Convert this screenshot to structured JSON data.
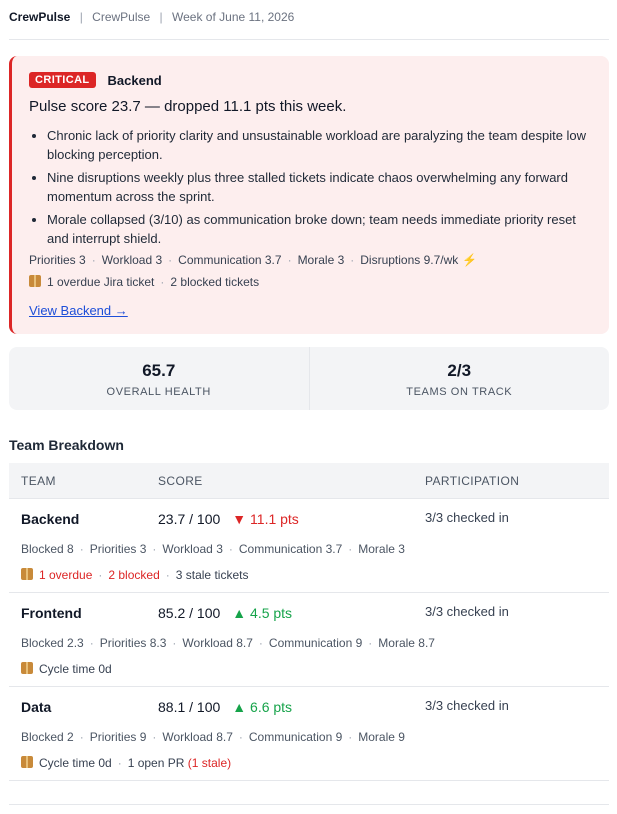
{
  "header": {
    "app_name": "CrewPulse",
    "org_name": "CrewPulse",
    "week": "Week of June 11, 2026",
    "separator": "|"
  },
  "alert": {
    "badge": "CRITICAL",
    "team": "Backend",
    "summary": "Pulse score 23.7 — dropped 11.1 pts this week.",
    "bullets": [
      "Chronic lack of priority clarity and unsustainable workload are paralyzing the team despite low blocking perception.",
      "Nine disruptions weekly plus three stalled tickets indicate chaos overwhelming any forward momentum across the sprint.",
      "Morale collapsed (3/10) as communication broke down; team needs immediate priority reset and interrupt shield."
    ],
    "metrics": [
      "Priorities 3",
      "Workload 3",
      "Communication 3.7",
      "Morale 3",
      "Disruptions 9.7/wk"
    ],
    "tickets": [
      "1 overdue Jira ticket",
      "2 blocked tickets"
    ],
    "link": "View Backend →"
  },
  "stats": {
    "overall_health_value": "65.7",
    "overall_health_label": "Overall Health",
    "teams_on_track_value": "2/3",
    "teams_on_track_label": "Teams on Track"
  },
  "section_title": "Team Breakdown",
  "table": {
    "columns": {
      "team": "Team",
      "score": "Score",
      "participation": "Participation"
    },
    "rows": [
      {
        "team": "Backend",
        "score": "23.7 / 100",
        "delta_arrow": "▼",
        "delta": "11.1 pts",
        "participation": "3/3 checked in",
        "details": [
          "Blocked 8",
          "Priorities 3",
          "Workload 3",
          "Communication 3.7",
          "Morale 3"
        ],
        "extra_overdue": "1 overdue",
        "extra_blocked": "2 blocked",
        "extra_stale": "3 stale tickets"
      },
      {
        "team": "Frontend",
        "score": "85.2 / 100",
        "delta_arrow": "▲",
        "delta": "4.5 pts",
        "participation": "3/3 checked in",
        "details": [
          "Blocked 2.3",
          "Priorities 8.3",
          "Workload 8.7",
          "Communication 9",
          "Morale 8.7"
        ],
        "extra_cycle": "Cycle time 0d"
      },
      {
        "team": "Data",
        "score": "88.1 / 100",
        "delta_arrow": "▲",
        "delta": "6.6 pts",
        "participation": "3/3 checked in",
        "details": [
          "Blocked 2",
          "Priorities 9",
          "Workload 8.7",
          "Communication 9",
          "Morale 9"
        ],
        "extra_cycle": "Cycle time 0d",
        "extra_pr": "1 open PR",
        "extra_pr_stale": "(1 stale)"
      }
    ]
  },
  "colors": {
    "critical": "#dc2626",
    "alert_bg": "#fdeeee",
    "positive": "#16a34a",
    "link": "#1d4ed8"
  },
  "icons": {
    "package": "package-icon",
    "bolt": "lightning-icon",
    "down": "triangle-down-icon",
    "up": "triangle-up-icon"
  }
}
